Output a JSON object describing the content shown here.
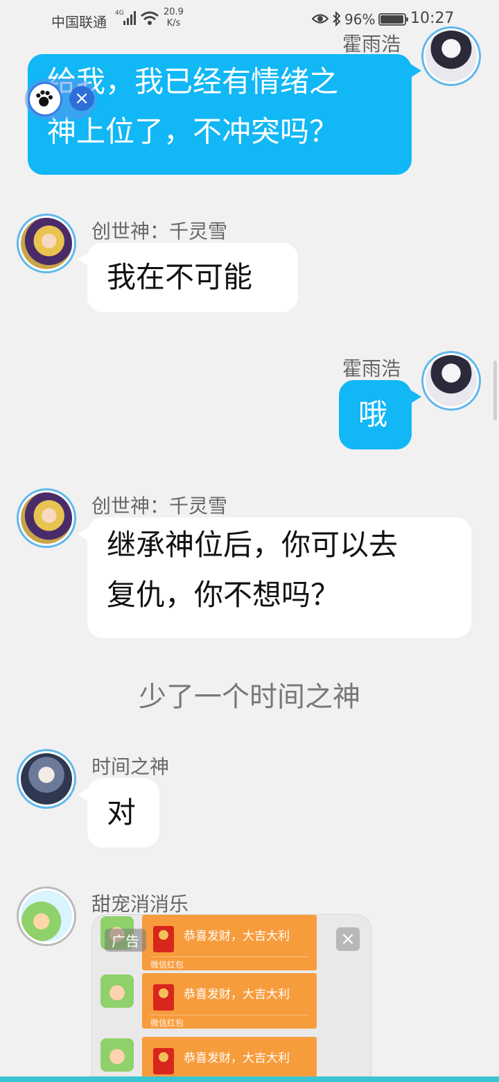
{
  "status_bar": {
    "carrier": "中国联通",
    "network_type": "4G",
    "speed_value": "20.9",
    "speed_unit": "K/s",
    "battery": "96%",
    "time": "10:27"
  },
  "messages": [
    {
      "sender": "霍雨浩",
      "direction": "out",
      "avatar": "avatar-huo-yuhao",
      "lines": [
        "给我，我已经有情绪之",
        "神上位了，不冲突吗？"
      ]
    },
    {
      "sender": "创世神：千灵雪",
      "direction": "in",
      "avatar": "avatar-qian-lingxue",
      "lines": [
        "我在不可能"
      ]
    },
    {
      "sender": "霍雨浩",
      "direction": "out",
      "avatar": "avatar-huo-yuhao",
      "lines": [
        "哦"
      ]
    },
    {
      "sender": "创世神：千灵雪",
      "direction": "in",
      "avatar": "avatar-qian-lingxue",
      "lines": [
        "继承神位后，你可以去",
        "复仇，你不想吗？"
      ]
    },
    {
      "narration": "少了一个时间之神"
    },
    {
      "sender": "时间之神",
      "direction": "in",
      "avatar": "avatar-time-god",
      "lines": [
        "对"
      ]
    },
    {
      "sender": "甜宠消消乐",
      "direction": "in",
      "avatar": "avatar-game"
    }
  ],
  "ad": {
    "tag": "广告",
    "close": "×",
    "packets": [
      {
        "title": "恭喜发财，大吉大利",
        "subtitle": "微信红包"
      },
      {
        "title": "恭喜发财，大吉大利",
        "subtitle": "微信红包"
      },
      {
        "title": "恭喜发财，大吉大利",
        "subtitle": ""
      }
    ]
  },
  "float_widget": {
    "icon": "paw-icon",
    "close": "×"
  },
  "colors": {
    "background": "#f1f1f1",
    "outgoing_bubble": "#12b7f5",
    "incoming_bubble": "#ffffff",
    "red_packet": "#f79c3c"
  }
}
